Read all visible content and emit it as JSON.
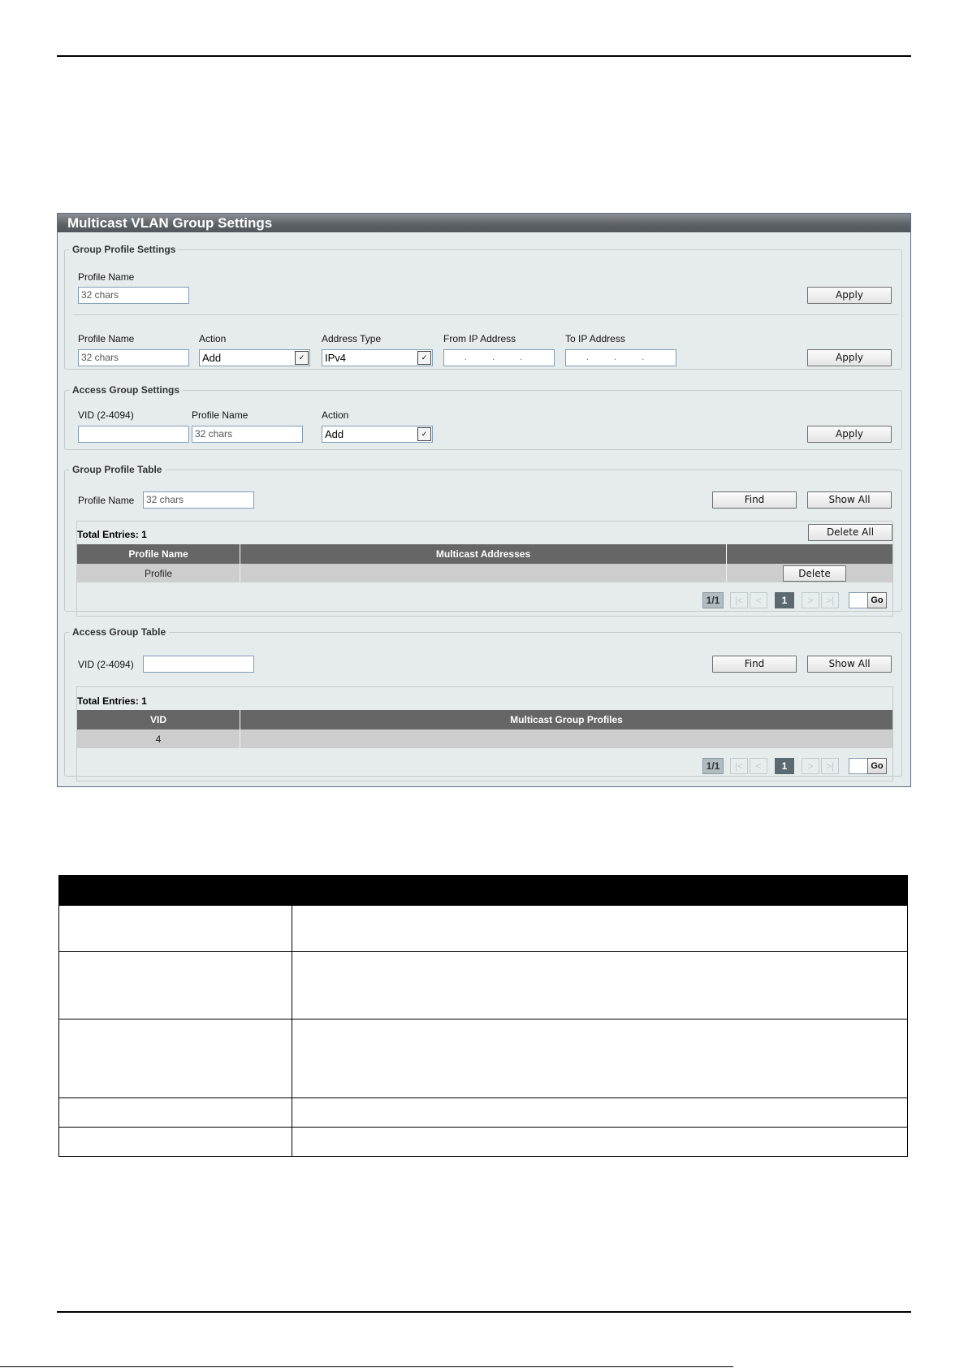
{
  "panel": {
    "title": "Multicast VLAN Group Settings",
    "group_profile_settings": {
      "legend": "Group Profile Settings",
      "profile_name_label": "Profile Name",
      "profile_name_placeholder": "32 chars",
      "apply_label": "Apply",
      "row2": {
        "profile_name_label": "Profile Name",
        "profile_name_placeholder": "32 chars",
        "action_label": "Action",
        "action_value": "Add",
        "address_type_label": "Address Type",
        "address_type_value": "IPv4",
        "from_ip_label": "From IP Address",
        "from_ip_dots": ". . .",
        "to_ip_label": "To IP Address",
        "to_ip_dots": ". . .",
        "apply_label": "Apply"
      }
    },
    "access_group_settings": {
      "legend": "Access Group Settings",
      "vid_label": "VID (2-4094)",
      "vid_value": "",
      "profile_name_label": "Profile Name",
      "profile_name_placeholder": "32 chars",
      "action_label": "Action",
      "action_value": "Add",
      "apply_label": "Apply"
    },
    "group_profile_table": {
      "legend": "Group Profile Table",
      "profile_name_label": "Profile Name",
      "profile_name_placeholder": "32 chars",
      "find_label": "Find",
      "show_all_label": "Show All",
      "total_entries": "Total Entries: 1",
      "delete_all_label": "Delete All",
      "columns": [
        "Profile Name",
        "Multicast Addresses",
        ""
      ],
      "rows": [
        {
          "profile_name": "Profile",
          "multicast_addresses": "",
          "action_label": "Delete"
        }
      ],
      "pager": {
        "count": "1/1",
        "first": "|<",
        "prev": "<",
        "current": "1",
        "next": ">",
        "last": ">|",
        "go_label": "Go"
      }
    },
    "access_group_table": {
      "legend": "Access Group Table",
      "vid_label": "VID (2-4094)",
      "vid_value": "",
      "find_label": "Find",
      "show_all_label": "Show All",
      "total_entries": "Total Entries: 1",
      "columns": [
        "VID",
        "Multicast Group Profiles"
      ],
      "rows": [
        {
          "vid": "4",
          "profiles": ""
        }
      ],
      "pager": {
        "count": "1/1",
        "first": "|<",
        "prev": "<",
        "current": "1",
        "next": ">",
        "last": ">|",
        "go_label": "Go"
      }
    }
  },
  "colors": {
    "panel_bg": "#e6ecec",
    "title_bar": "#5c6166",
    "table_header": "#666666",
    "table_row": "#cdcdcd"
  }
}
